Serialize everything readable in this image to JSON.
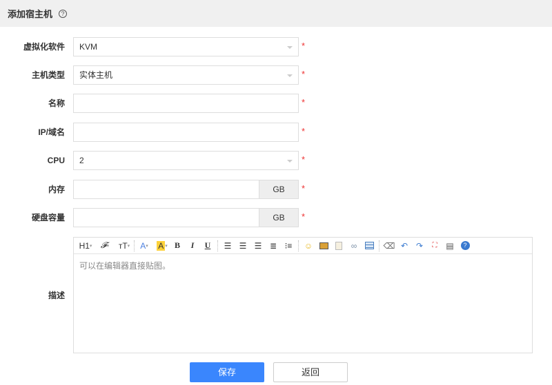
{
  "header": {
    "title": "添加宿主机",
    "help_icon": "?"
  },
  "form": {
    "virt": {
      "label": "虚拟化软件",
      "value": "KVM"
    },
    "host_type": {
      "label": "主机类型",
      "value": "实体主机"
    },
    "name": {
      "label": "名称",
      "value": ""
    },
    "ip": {
      "label": "IP/域名",
      "value": ""
    },
    "cpu": {
      "label": "CPU",
      "value": "2"
    },
    "memory": {
      "label": "内存",
      "value": "",
      "unit": "GB"
    },
    "disk": {
      "label": "硬盘容量",
      "value": "",
      "unit": "GB"
    },
    "desc": {
      "label": "描述",
      "placeholder": "可以在编辑器直接贴图。"
    },
    "required_mark": "*"
  },
  "toolbar": {
    "h1": "H1",
    "font": "𝓕",
    "size": "тT",
    "fontcolor": "A",
    "bgcolor": "A",
    "bold": "B",
    "italic": "I",
    "underline": "U"
  },
  "buttons": {
    "save": "保存",
    "back": "返回"
  }
}
